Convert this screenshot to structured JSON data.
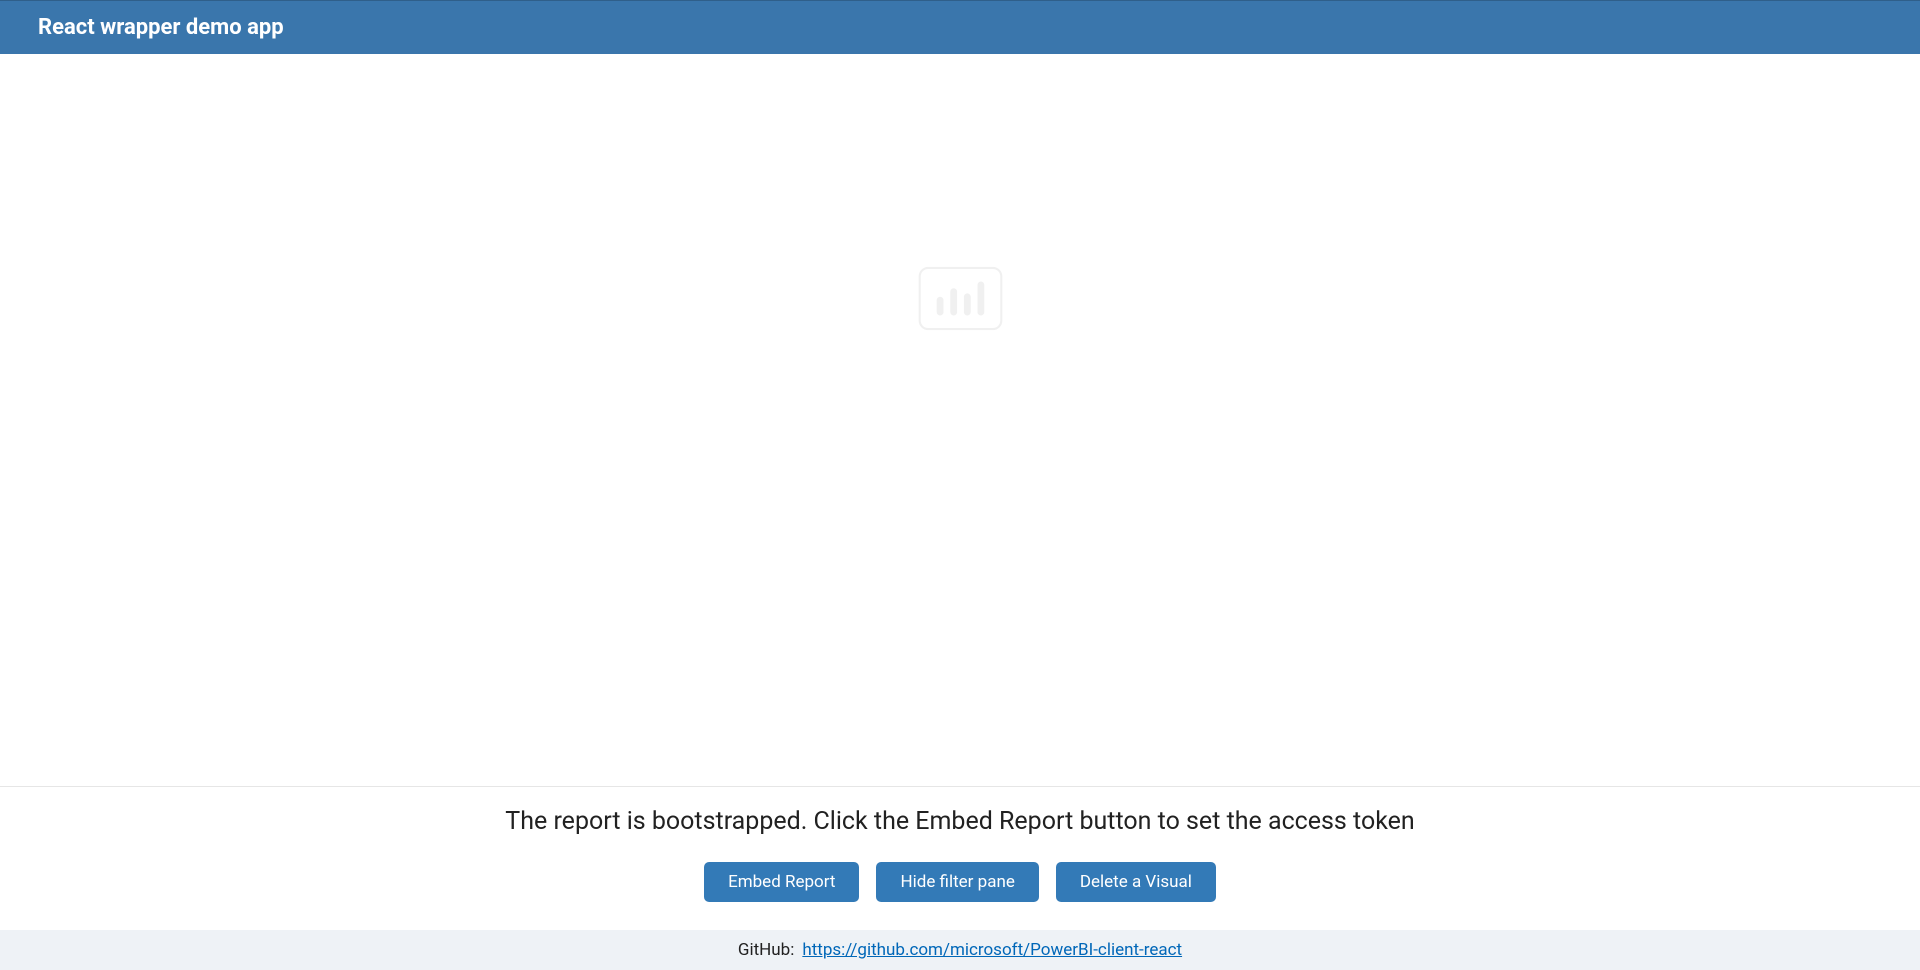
{
  "header": {
    "title": "React wrapper demo app"
  },
  "report": {
    "placeholder_icon": "powerbi-logo-icon"
  },
  "status": {
    "message": "The report is bootstrapped. Click the Embed Report button to set the access token"
  },
  "buttons": {
    "embed_report": "Embed Report",
    "hide_filter_pane": "Hide filter pane",
    "delete_visual": "Delete a Visual"
  },
  "footer": {
    "label": "GitHub:",
    "link_text": "https://github.com/microsoft/PowerBI-client-react",
    "link_href": "https://github.com/microsoft/PowerBI-client-react"
  },
  "colors": {
    "header_bg": "#3a76ac",
    "button_bg": "#337ab7",
    "footer_bg": "#eef2f6",
    "link": "#0067b8"
  }
}
